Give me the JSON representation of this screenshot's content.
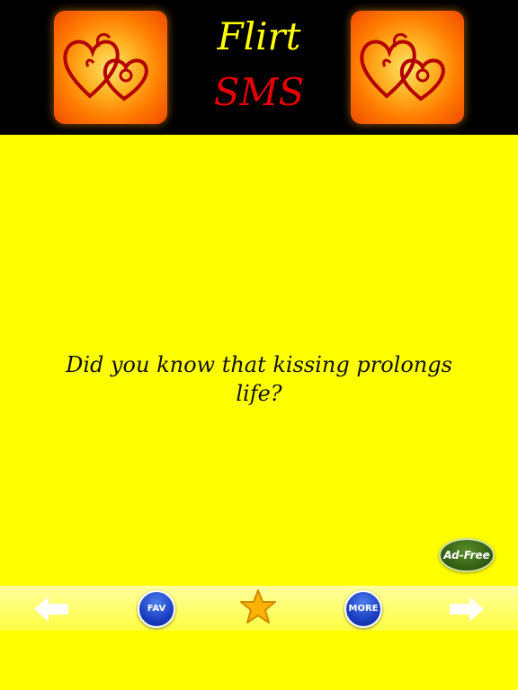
{
  "header": {
    "title_line1": "Flirt",
    "title_line2": "SMS",
    "logo_left_icon": "hearts-icon",
    "logo_right_icon": "hearts-icon"
  },
  "message": {
    "text": "Did you know that kissing prolongs life?"
  },
  "ad_free": {
    "label": "Ad-Free"
  },
  "toolbar": {
    "prev_icon": "arrow-left-icon",
    "fav_label": "FAV",
    "star_icon": "star-icon",
    "more_label": "MORE",
    "next_icon": "arrow-right-icon"
  },
  "colors": {
    "background": "#ffff00",
    "header": "#000000",
    "title_flirt": "#ffff00",
    "title_sms": "#e60000",
    "button_blue": "#1b3fc0"
  }
}
